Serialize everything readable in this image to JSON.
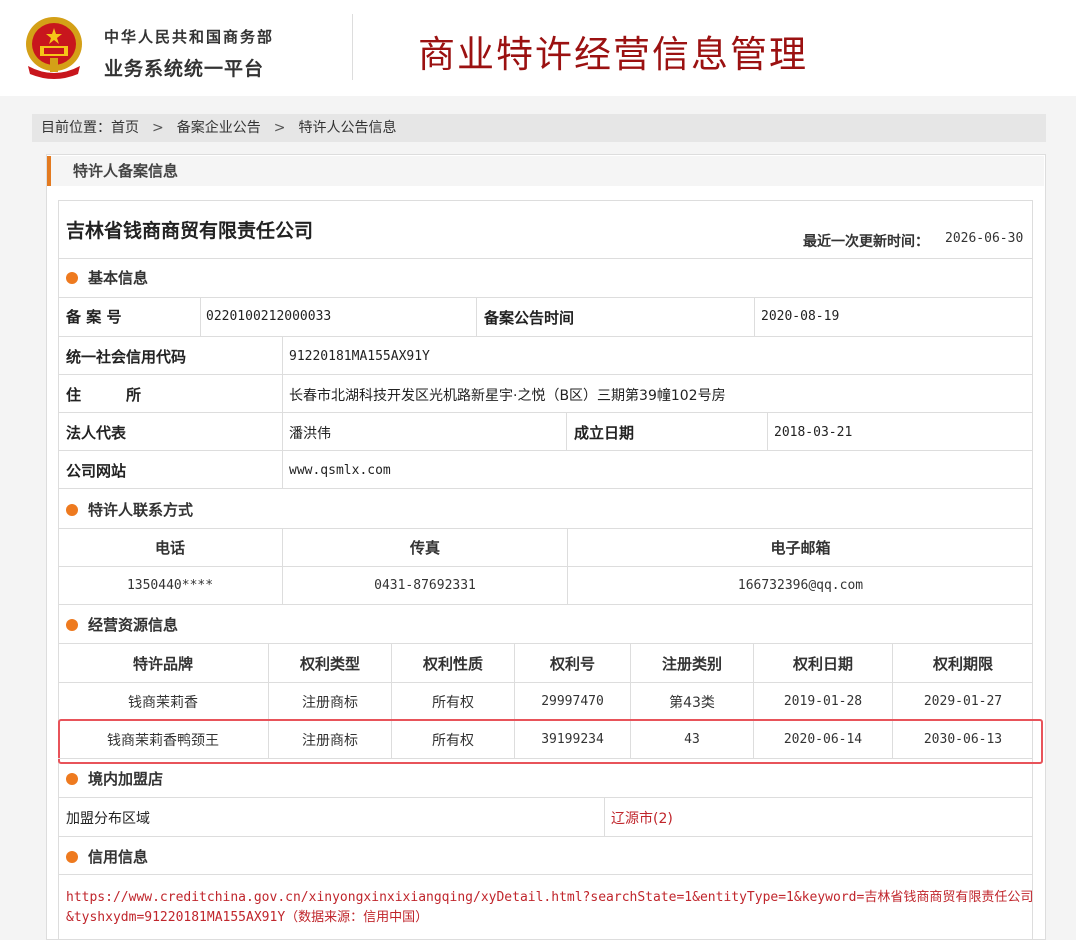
{
  "header": {
    "org_line1": "中华人民共和国商务部",
    "org_line2": "业务系统统一平台",
    "site_title": "商业特许经营信息管理"
  },
  "breadcrumb": {
    "prefix": "目前位置：",
    "items": [
      "首页",
      "备案企业公告",
      "特许人公告信息"
    ],
    "separator": ">"
  },
  "panel": {
    "title": "特许人备案信息"
  },
  "company": {
    "name": "吉林省钱商商贸有限责任公司",
    "updated_label": "最近一次更新时间：",
    "updated_value": "2026-06-30"
  },
  "basic": {
    "section_title": "基本信息",
    "record_no_label": "备 案 号",
    "record_no": "0220100212000033",
    "announce_label": "备案公告时间",
    "announce_date": "2020-08-19",
    "credit_code_label": "统一社会信用代码",
    "credit_code": "91220181MA155AX91Y",
    "address_label": "住　　　所",
    "address": "长春市北湖科技开发区光机路新星宇·之悦（B区）三期第39幢102号房",
    "legal_rep_label": "法人代表",
    "legal_rep": "潘洪伟",
    "founded_label": "成立日期",
    "founded": "2018-03-21",
    "website_label": "公司网站",
    "website": "www.qsmlx.com"
  },
  "contact": {
    "section_title": "特许人联系方式",
    "headers": [
      "电话",
      "传真",
      "电子邮箱"
    ],
    "phone": "1350440****",
    "fax": "0431-87692331",
    "email": "166732396@qq.com"
  },
  "resources": {
    "section_title": "经营资源信息",
    "headers": [
      "特许品牌",
      "权利类型",
      "权利性质",
      "权利号",
      "注册类别",
      "权利日期",
      "权利期限"
    ],
    "rows": [
      [
        "钱商茉莉香",
        "注册商标",
        "所有权",
        "29997470",
        "第43类",
        "2019-01-28",
        "2029-01-27"
      ],
      [
        "钱商茉莉香鸭颈王",
        "注册商标",
        "所有权",
        "39199234",
        "43",
        "2020-06-14",
        "2030-06-13"
      ]
    ]
  },
  "franchise": {
    "section_title": "境内加盟店",
    "region_label": "加盟分布区域",
    "region_value": "辽源市(2)"
  },
  "credit": {
    "section_title": "信用信息",
    "url_line1": "https://www.creditchina.gov.cn/xinyongxinxixiangqing/xyDetail.html?searchState=1&entityType=1&keyword=吉林省钱商商贸有限责任公司",
    "url_line2": "&tyshxydm=91220181MA155AX91Y（数据来源：信用中国）"
  },
  "colors": {
    "title_red": "#9b1111",
    "accent_orange": "#ee7a1f",
    "link_red": "#c0262c",
    "highlight_border": "#e8535a"
  }
}
